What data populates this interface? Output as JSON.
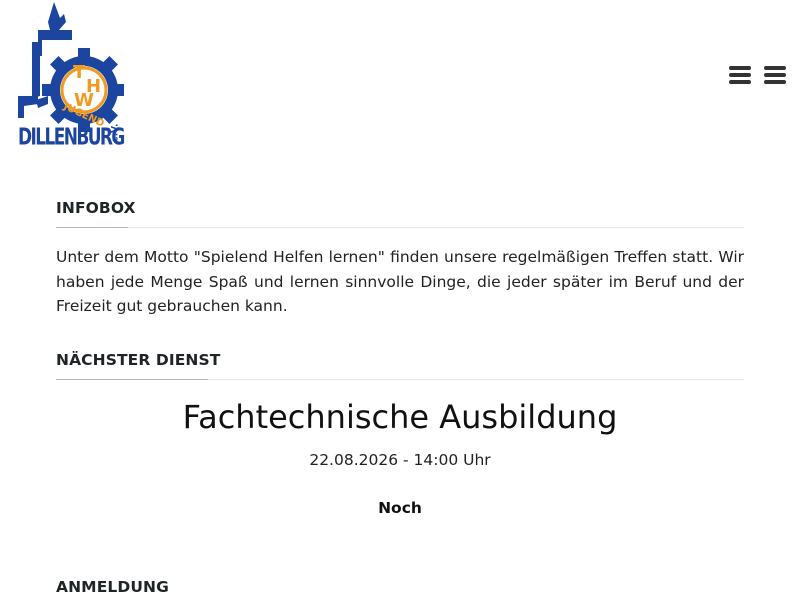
{
  "logo": {
    "ring_text": "JUGEND",
    "wordmark": "DILLENBURG",
    "suffix": "e.V.",
    "letters": [
      "T",
      "H",
      "W"
    ],
    "colors": {
      "blue": "#1c45a0",
      "orange": "#f29a1f"
    }
  },
  "header": {
    "menu_icons": [
      "menu-icon",
      "menu-icon"
    ]
  },
  "infobox": {
    "title": "INFOBOX",
    "text": "Unter dem Motto \"Spielend Helfen lernen\" finden unsere regelmäßigen Treffen statt. Wir haben jede Menge Spaß und lernen sinnvolle Dinge, die jeder später im Beruf und der Freizeit gut gebrauchen kann."
  },
  "next_service": {
    "title": "NÄCHSTER DIENST",
    "event_name": "Fachtechnische Ausbildung",
    "datetime": "22.08.2026 - 14:00 Uhr",
    "countdown_label": "Noch"
  },
  "registration": {
    "title": "ANMELDUNG"
  }
}
